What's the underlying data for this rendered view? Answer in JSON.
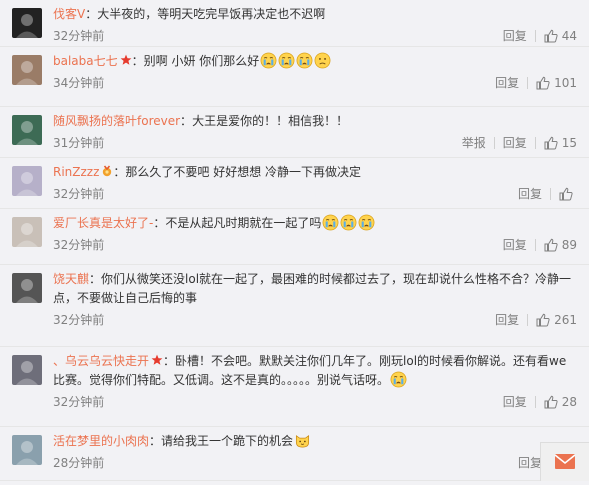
{
  "comments": [
    {
      "user": "伐客V",
      "sep": "：",
      "text": "大半夜的，等明天吃完早饭再决定也不迟啊",
      "emojis": [],
      "time": "32分钟前",
      "actions": [
        "回复"
      ],
      "likes": "44",
      "avatar_color": "#222222"
    },
    {
      "user": "balaba七七",
      "badge": "star",
      "sep": "：",
      "text": "别啊 小妍 你们那么好",
      "emojis": [
        "cry",
        "cry",
        "cry",
        "sad"
      ],
      "time": "34分钟前",
      "actions": [
        "回复"
      ],
      "likes": "101",
      "avatar_color": "#9a7c67"
    },
    {
      "user": "随风飘扬的落叶forever",
      "sep": "：",
      "text": "大王是爱你的！！相信我！！",
      "emojis": [],
      "time": "31分钟前",
      "actions": [
        "举报",
        "回复"
      ],
      "likes": "15",
      "avatar_color": "#3d6b55"
    },
    {
      "user": "RinZzzz",
      "badge": "medal",
      "sep": "：",
      "text": "那么久了不要吧 好好想想 冷静一下再做决定",
      "emojis": [],
      "time": "32分钟前",
      "actions": [
        "回复"
      ],
      "likes": "",
      "avatar_color": "#b6b0c9"
    },
    {
      "user": "爱厂长真是太好了-",
      "sep": "：",
      "text": "不是从起凡时期就在一起了吗",
      "emojis": [
        "cry",
        "cry",
        "cry"
      ],
      "time": "32分钟前",
      "actions": [
        "回复"
      ],
      "likes": "89",
      "avatar_color": "#c9c0b8"
    },
    {
      "user": "饶天麒",
      "sep": "：",
      "text": "你们从微笑还没lol就在一起了，最困难的时候都过去了，现在却说什么性格不合？冷静一点，不要做让自己后悔的事",
      "emojis": [],
      "time": "32分钟前",
      "actions": [
        "回复"
      ],
      "likes": "261",
      "avatar_color": "#555555"
    },
    {
      "user": "、乌云乌云快走开",
      "badge": "star",
      "sep": "：",
      "text": "卧槽！不会吧。默默关注你们几年了。刚玩lol的时候看你解说。还有看we比赛。觉得你们特配。又低调。这不是真的。。。。。别说气话呀。",
      "emojis": [
        "cry"
      ],
      "time": "32分钟前",
      "actions": [
        "回复"
      ],
      "likes": "28",
      "avatar_color": "#6e6e7a"
    },
    {
      "user": "活在梦里的小肉肉",
      "sep": "：",
      "text": "请给我王一个跪下的机会",
      "emojis": [
        "cat"
      ],
      "time": "28分钟前",
      "actions": [
        "回复"
      ],
      "likes": "",
      "avatar_color": "#8aa0ad"
    }
  ],
  "colors": {
    "username": "#eb7350",
    "text": "#333333",
    "meta": "#808080",
    "background": "#f2f2f5"
  }
}
